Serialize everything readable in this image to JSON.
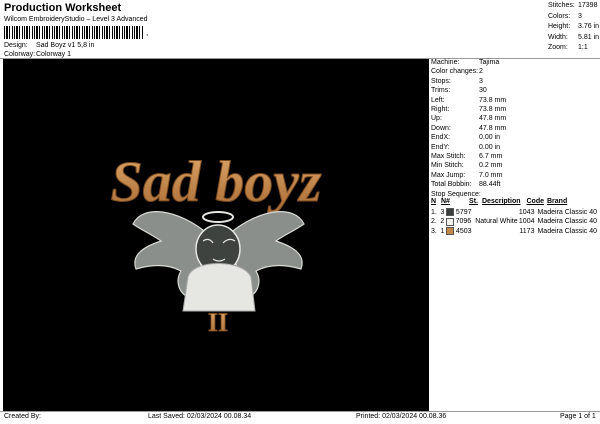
{
  "header": {
    "title": "Production Worksheet",
    "subtitle": "Wilcom EmbroideryStudio – Level 3 Advanced",
    "barcode_mark": ","
  },
  "meta": {
    "design_label": "Design:",
    "design_value": "Sad Boyz v1 5,8 in",
    "colorway_label": "Colorway:",
    "colorway_value": "Colorway 1"
  },
  "stats": [
    {
      "k": "Stitches:",
      "v": "17398"
    },
    {
      "k": "Colors:",
      "v": "3"
    },
    {
      "k": "Height:",
      "v": "3.76 in"
    },
    {
      "k": "Width:",
      "v": "5.81 in"
    },
    {
      "k": "Zoom:",
      "v": "1:1"
    }
  ],
  "design_art": {
    "text_main": "Sad boyz",
    "text_numeral": "II",
    "colors": {
      "gold": "#c4874a",
      "white": "#e6e6e2",
      "gray": "#8a8f8c"
    }
  },
  "machine_info": [
    {
      "k": "Machine:",
      "v": "Tajima"
    },
    {
      "k": "Color changes:",
      "v": "2"
    },
    {
      "k": "Stops:",
      "v": "3"
    },
    {
      "k": "Trims:",
      "v": "30"
    },
    {
      "k": "Left:",
      "v": "73.8 mm"
    },
    {
      "k": "Right:",
      "v": "73.8 mm"
    },
    {
      "k": "Up:",
      "v": "47.8 mm"
    },
    {
      "k": "Down:",
      "v": "47.8 mm"
    },
    {
      "k": "EndX:",
      "v": "0.00 in"
    },
    {
      "k": "EndY:",
      "v": "0.00 in"
    },
    {
      "k": "Max Stitch:",
      "v": "6.7 mm"
    },
    {
      "k": "Min Stitch:",
      "v": "0.2 mm"
    },
    {
      "k": "Max Jump:",
      "v": "7.0 mm"
    },
    {
      "k": "Total Bobbin:",
      "v": "88.44ft"
    }
  ],
  "stop_sequence": {
    "title": "Stop Sequence:",
    "headers": [
      "N",
      "N#",
      "St.",
      "Description",
      "Code",
      "Brand"
    ],
    "rows": [
      {
        "n": "1.",
        "num": "3",
        "color": "#3a3f3d",
        "st": "5797",
        "desc": "",
        "code": "1043",
        "brand": "Madeira Classic 40"
      },
      {
        "n": "2.",
        "num": "2",
        "color": "#f2f2ef",
        "st": "7096",
        "desc": "Natural White",
        "code": "1004",
        "brand": "Madeira Classic 40"
      },
      {
        "n": "3.",
        "num": "1",
        "color": "#c4874a",
        "st": "4503",
        "desc": "",
        "code": "1173",
        "brand": "Madeira Classic 40"
      }
    ]
  },
  "footer": {
    "created_by": "Created By:",
    "last_saved": "Last Saved: 02/03/2024 00.08.34",
    "printed": "Printed: 02/03/2024 00.08.36",
    "page": "Page 1 of 1"
  }
}
